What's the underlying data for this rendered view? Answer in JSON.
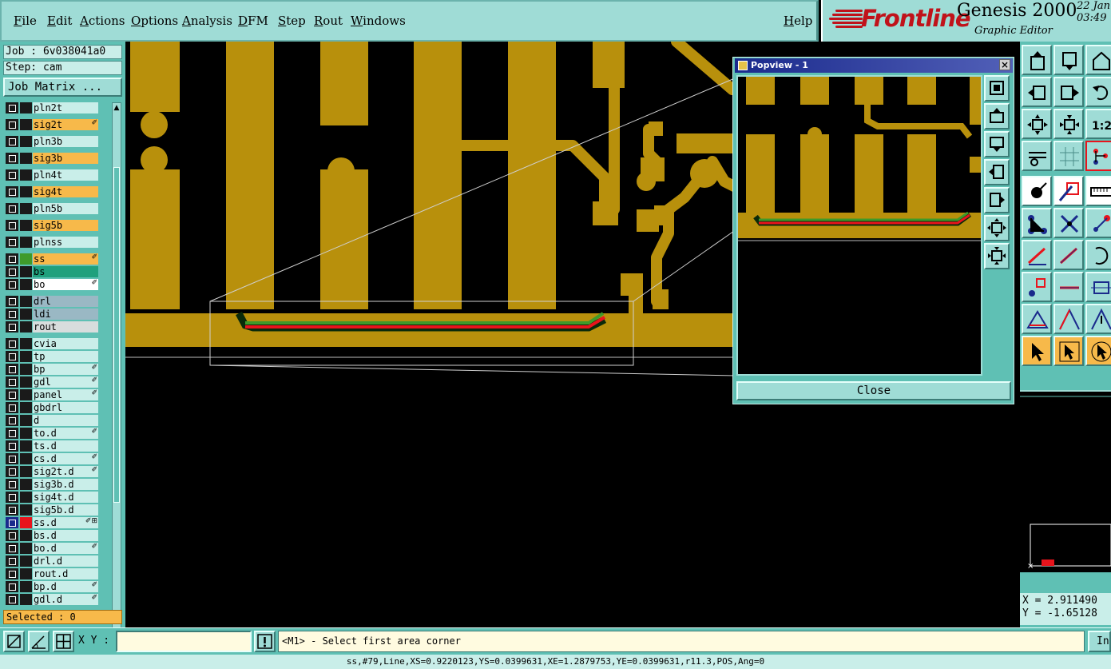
{
  "menu": {
    "items": [
      "File",
      "Edit",
      "Actions",
      "Options",
      "Analysis",
      "DFM",
      "Step",
      "Rout",
      "Windows"
    ],
    "help": "Help"
  },
  "brand": {
    "logo": "Frontline",
    "product": "Genesis 2000",
    "subtitle": "Graphic Editor",
    "date_line1": "22 Jan",
    "date_line2": "03:49"
  },
  "job": {
    "job_label": "Job : 6v038041a0",
    "step_label": "Step: cam",
    "matrix_button": "Job Matrix ..."
  },
  "layers": [
    {
      "name": "pln2t",
      "bg": "#c9eee9",
      "swatch": "#1a1a1a",
      "flag": ""
    },
    {
      "name": "sig2t",
      "bg": "#f7b94a",
      "swatch": "#1a1a1a",
      "flag": "✐"
    },
    {
      "name": "pln3b",
      "bg": "#c9eee9",
      "swatch": "#1a1a1a",
      "flag": ""
    },
    {
      "name": "sig3b",
      "bg": "#f7b94a",
      "swatch": "#1a1a1a",
      "flag": ""
    },
    {
      "name": "pln4t",
      "bg": "#c9eee9",
      "swatch": "#1a1a1a",
      "flag": ""
    },
    {
      "name": "sig4t",
      "bg": "#f7b94a",
      "swatch": "#1a1a1a",
      "flag": ""
    },
    {
      "name": "pln5b",
      "bg": "#c9eee9",
      "swatch": "#1a1a1a",
      "flag": ""
    },
    {
      "name": "sig5b",
      "bg": "#f7b94a",
      "swatch": "#1a1a1a",
      "flag": ""
    },
    {
      "name": "plnss",
      "bg": "#c9eee9",
      "swatch": "#1a1a1a",
      "flag": ""
    },
    {
      "name": "ss",
      "bg": "#f7b94a",
      "swatch": "#3f9a2a",
      "flag": "✐"
    },
    {
      "name": "bs",
      "bg": "#1fa07d",
      "swatch": "#1a1a1a",
      "flag": ""
    },
    {
      "name": "bo",
      "bg": "#ffffff",
      "swatch": "#1a1a1a",
      "flag": "✐"
    },
    {
      "name": "drl",
      "bg": "#9ab8c4",
      "swatch": "#1a1a1a",
      "flag": ""
    },
    {
      "name": "ldi",
      "bg": "#9ab8c4",
      "swatch": "#1a1a1a",
      "flag": ""
    },
    {
      "name": "rout",
      "bg": "#d8dddd",
      "swatch": "#1a1a1a",
      "flag": ""
    },
    {
      "name": "cvia",
      "bg": "#c9eee9",
      "swatch": "#1a1a1a",
      "flag": ""
    },
    {
      "name": "tp",
      "bg": "#c9eee9",
      "swatch": "#1a1a1a",
      "flag": ""
    },
    {
      "name": "bp",
      "bg": "#c9eee9",
      "swatch": "#1a1a1a",
      "flag": "✐"
    },
    {
      "name": "gdl",
      "bg": "#c9eee9",
      "swatch": "#1a1a1a",
      "flag": "✐"
    },
    {
      "name": "panel",
      "bg": "#c9eee9",
      "swatch": "#1a1a1a",
      "flag": "✐"
    },
    {
      "name": "gbdrl",
      "bg": "#c9eee9",
      "swatch": "#1a1a1a",
      "flag": ""
    },
    {
      "name": "d",
      "bg": "#c9eee9",
      "swatch": "#1a1a1a",
      "flag": ""
    },
    {
      "name": "to.d",
      "bg": "#c9eee9",
      "swatch": "#1a1a1a",
      "flag": "✐"
    },
    {
      "name": "ts.d",
      "bg": "#c9eee9",
      "swatch": "#1a1a1a",
      "flag": ""
    },
    {
      "name": "cs.d",
      "bg": "#c9eee9",
      "swatch": "#1a1a1a",
      "flag": "✐"
    },
    {
      "name": "sig2t.d",
      "bg": "#c9eee9",
      "swatch": "#1a1a1a",
      "flag": "✐"
    },
    {
      "name": "sig3b.d",
      "bg": "#c9eee9",
      "swatch": "#1a1a1a",
      "flag": ""
    },
    {
      "name": "sig4t.d",
      "bg": "#c9eee9",
      "swatch": "#1a1a1a",
      "flag": ""
    },
    {
      "name": "sig5b.d",
      "bg": "#c9eee9",
      "swatch": "#1a1a1a",
      "flag": ""
    },
    {
      "name": "ss.d",
      "bg": "#c9eee9",
      "swatch": "#e8141c",
      "flag": "✐⊞",
      "checkbg": "#1a2a8c"
    },
    {
      "name": "bs.d",
      "bg": "#c9eee9",
      "swatch": "#1a1a1a",
      "flag": ""
    },
    {
      "name": "bo.d",
      "bg": "#c9eee9",
      "swatch": "#1a1a1a",
      "flag": "✐"
    },
    {
      "name": "drl.d",
      "bg": "#c9eee9",
      "swatch": "#1a1a1a",
      "flag": ""
    },
    {
      "name": "rout.d",
      "bg": "#c9eee9",
      "swatch": "#1a1a1a",
      "flag": ""
    },
    {
      "name": "bp.d",
      "bg": "#c9eee9",
      "swatch": "#1a1a1a",
      "flag": "✐"
    },
    {
      "name": "gdl.d",
      "bg": "#c9eee9",
      "swatch": "#1a1a1a",
      "flag": "✐"
    }
  ],
  "selected": "Selected : 0",
  "popview": {
    "title": "Popview - 1",
    "close_label": "Close"
  },
  "coords": {
    "x": "X = 2.911490",
    "y": "Y = -1.65128"
  },
  "bottom": {
    "xy_label": "X Y :",
    "xy_value": "",
    "prompt": "<M1> - Select first area corner",
    "in_label": "In"
  },
  "status": "ss,#79,Line,XS=0.9220123,YS=0.0399631,XE=1.2879753,YE=0.0399631,r11.3,POS,Ang=0",
  "colors": {
    "copper": "#b8900c",
    "panel": "#5fc0b4",
    "light": "#9fdcd6",
    "highlight": "#f7b94a",
    "trace_red": "#e8141c",
    "trace_green": "#3f9a2a"
  }
}
